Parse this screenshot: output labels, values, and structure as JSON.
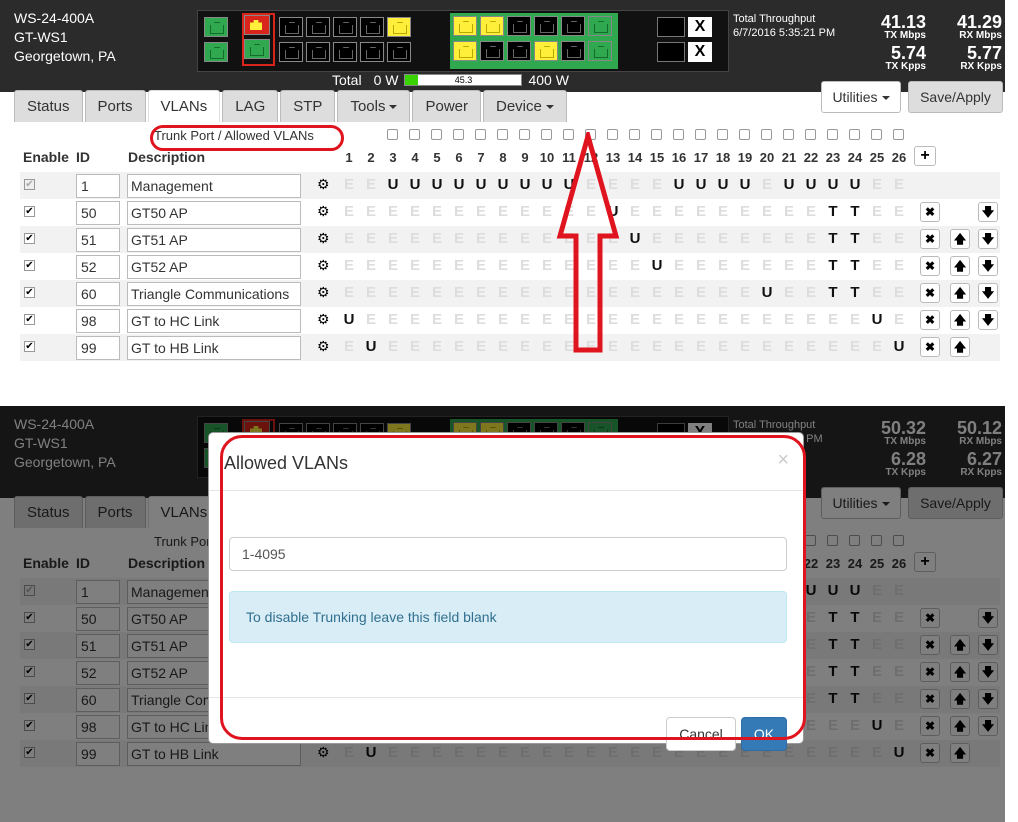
{
  "device": {
    "model": "WS-24-400A",
    "name": "GT-WS1",
    "location": "Georgetown, PA"
  },
  "power": {
    "total_label": "Total",
    "min": "0 W",
    "value": "45.3",
    "fill": 0.11,
    "max": "400 W"
  },
  "throughput_1": {
    "label": "Total Throughput",
    "timestamp": "6/7/2016 5:35:21 PM",
    "tx_mbps": "41.13",
    "rx_mbps": "41.29",
    "tx_kpps": "5.74",
    "rx_kpps": "5.77"
  },
  "throughput_2": {
    "label": "Total Throughput",
    "timestamp_partial": "5 PM",
    "tx_mbps": "50.32",
    "rx_mbps": "50.12",
    "tx_kpps": "6.28",
    "rx_kpps": "6.27"
  },
  "units": {
    "tx_mbps": "TX Mbps",
    "rx_mbps": "RX Mbps",
    "tx_kpps": "TX Kpps",
    "rx_kpps": "RX Kpps"
  },
  "tabs": [
    "Status",
    "Ports",
    "VLANs",
    "LAG",
    "STP",
    "Tools",
    "Power",
    "Device"
  ],
  "buttons": {
    "utilities": "Utilities",
    "save_apply": "Save/Apply",
    "plus": "+",
    "delete": "✖",
    "up": "🡅",
    "down": "🡇"
  },
  "table": {
    "trunk_label": "Trunk Port / Allowed VLANs",
    "headers": {
      "enable": "Enable",
      "id": "ID",
      "description": "Description"
    },
    "ports": [
      "1",
      "2",
      "3",
      "4",
      "5",
      "6",
      "7",
      "8",
      "9",
      "10",
      "11",
      "12",
      "13",
      "14",
      "15",
      "16",
      "17",
      "18",
      "19",
      "20",
      "21",
      "22",
      "23",
      "24",
      "25",
      "26"
    ],
    "rows": [
      {
        "id": "1",
        "desc": "Management",
        "cells": "EEUUUUUUUUUEEEEUUUUEUUUUEE"
      },
      {
        "id": "50",
        "desc": "GT50 AP",
        "cells": "EEEEEEEEEEEEUEEEEEEEEETTEE"
      },
      {
        "id": "51",
        "desc": "GT51 AP",
        "cells": "EEEEEEEEEEEEEUEEEEEEEETTEE"
      },
      {
        "id": "52",
        "desc": "GT52 AP",
        "cells": "EEEEEEEEEEEEEEUEEEEEEETTEE"
      },
      {
        "id": "60",
        "desc": "Triangle Communications",
        "cells": "EEEEEEEEEEEEEEEEEEEUEETTEE"
      },
      {
        "id": "98",
        "desc": "GT to HC Link",
        "cells": "UEEEEEEEEEEEEEEEEEEEEEEEUE"
      },
      {
        "id": "99",
        "desc": "GT to HB Link",
        "cells": "EUEEEEEEEEEEEEEEEEEEEEEEEU"
      }
    ]
  },
  "modal": {
    "title": "Allowed VLANs",
    "close": "×",
    "input_value": "1-4095",
    "info": "To disable Trunking leave this field blank",
    "cancel": "Cancel",
    "ok": "OK"
  },
  "colors": {
    "annotation": "#e0141e",
    "ok_button": "#337ab7",
    "power_fill": "#39d400"
  }
}
